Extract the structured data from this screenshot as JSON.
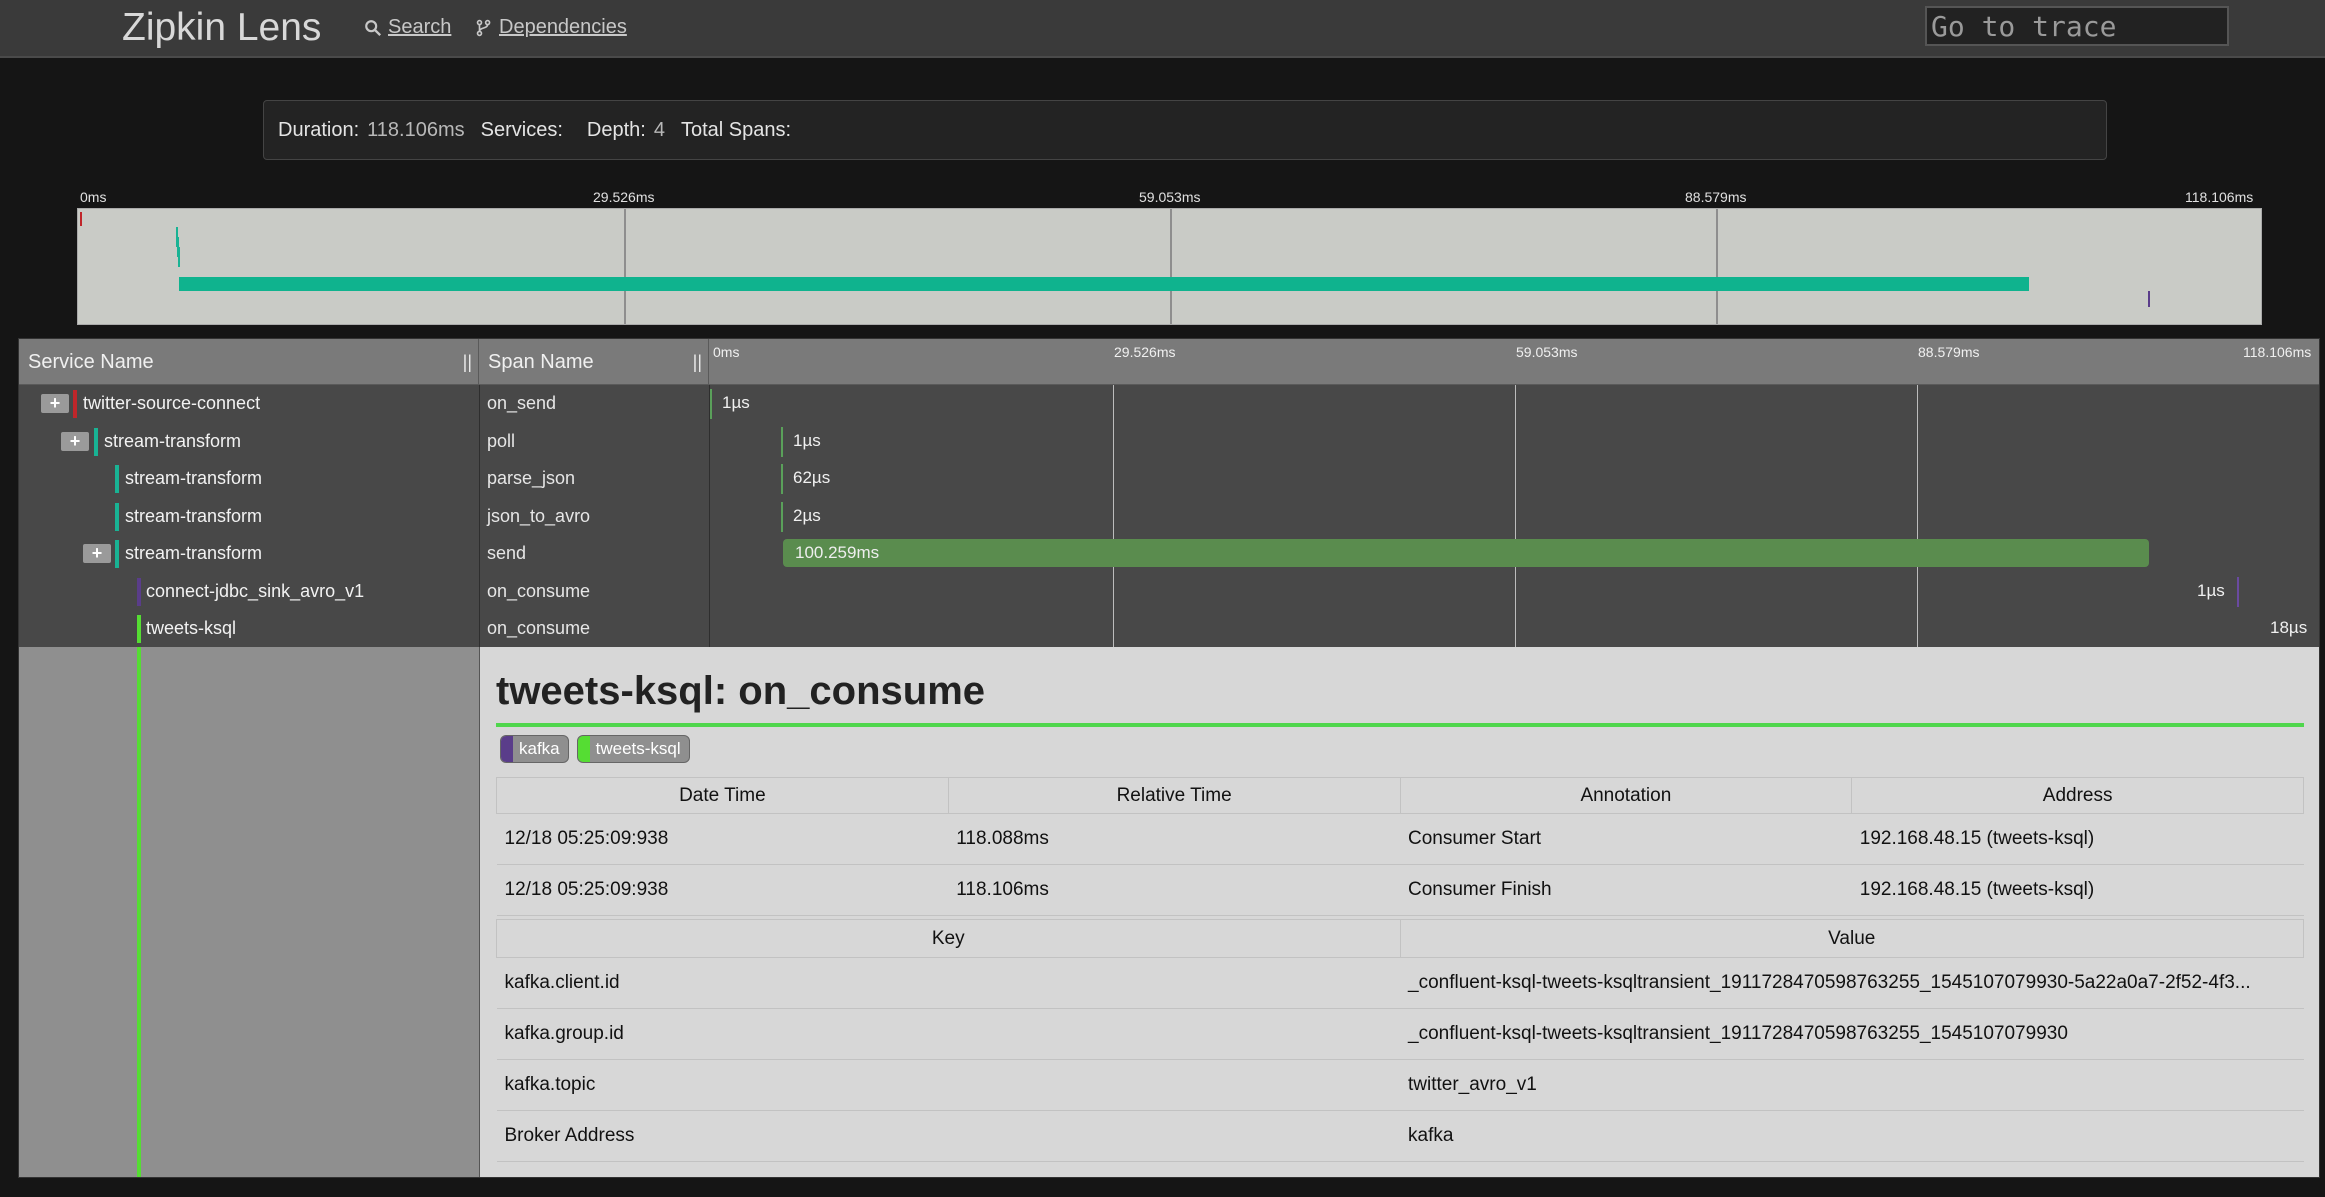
{
  "nav": {
    "brand": "Zipkin Lens",
    "search_label": "Search",
    "dependencies_label": "Dependencies",
    "goto_placeholder": "Go to trace"
  },
  "summary": {
    "duration_label": "Duration:",
    "duration_value": "118.106ms",
    "services_label": "Services:",
    "services_value": "",
    "depth_label": "Depth:",
    "depth_value": "4",
    "total_spans_label": "Total Spans:",
    "total_spans_value": ""
  },
  "timeline_ticks": [
    "0ms",
    "29.526ms",
    "59.053ms",
    "88.579ms",
    "118.106ms"
  ],
  "table_header": {
    "service_name": "Service Name",
    "span_name": "Span Name",
    "resizer": "||"
  },
  "rows": [
    {
      "service": "twitter-source-connect",
      "span": "on_send",
      "duration": "1µs",
      "color": "#c0262a",
      "toggle": "+"
    },
    {
      "service": "stream-transform",
      "span": "poll",
      "duration": "1µs",
      "color": "#19b394",
      "toggle": "+"
    },
    {
      "service": "stream-transform",
      "span": "parse_json",
      "duration": "62µs",
      "color": "#19b394"
    },
    {
      "service": "stream-transform",
      "span": "json_to_avro",
      "duration": "2µs",
      "color": "#19b394"
    },
    {
      "service": "stream-transform",
      "span": "send",
      "duration": "100.259ms",
      "color": "#19b394",
      "toggle": "+"
    },
    {
      "service": "connect-jdbc_sink_avro_v1",
      "span": "on_consume",
      "duration": "1µs",
      "color": "#5a3d8a"
    },
    {
      "service": "tweets-ksql",
      "span": "on_consume",
      "duration": "18µs",
      "color": "#55dd33"
    }
  ],
  "detail": {
    "title": "tweets-ksql: on_consume",
    "badges": [
      {
        "label": "kafka",
        "color": "#5a3d8a"
      },
      {
        "label": "tweets-ksql",
        "color": "#55dd33"
      }
    ],
    "annotation_headers": [
      "Date Time",
      "Relative Time",
      "Annotation",
      "Address"
    ],
    "annotations": [
      {
        "date": "12/18 05:25:09:938",
        "relative": "118.088ms",
        "annotation": "Consumer Start",
        "address": "192.168.48.15 (tweets-ksql)"
      },
      {
        "date": "12/18 05:25:09:938",
        "relative": "118.106ms",
        "annotation": "Consumer Finish",
        "address": "192.168.48.15 (tweets-ksql)"
      }
    ],
    "kv_headers": [
      "Key",
      "Value"
    ],
    "tags": [
      {
        "key": "kafka.client.id",
        "value": "_confluent-ksql-tweets-ksqltransient_1911728470598763255_1545107079930-5a22a0a7-2f52-4f3..."
      },
      {
        "key": "kafka.group.id",
        "value": "_confluent-ksql-tweets-ksqltransient_1911728470598763255_1545107079930"
      },
      {
        "key": "kafka.topic",
        "value": "twitter_avro_v1"
      },
      {
        "key": "Broker Address",
        "value": "kafka"
      }
    ]
  },
  "colors": {
    "accent_green": "#55dd33",
    "teal": "#19b394",
    "red": "#c0262a",
    "purple": "#5a3d8a"
  }
}
